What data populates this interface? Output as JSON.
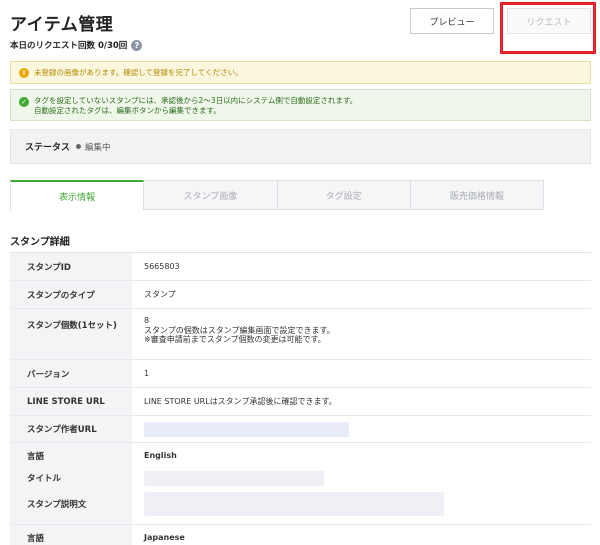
{
  "header": {
    "title": "アイテム管理",
    "request_count": "本日のリクエスト回数 0/30回",
    "help_icon": "question-circle-icon",
    "preview_label": "プレビュー",
    "request_label": "リクエスト"
  },
  "notices": {
    "warning_icon": "exclamation-circle-icon",
    "warning_text": "未登録の画像があります。確認して登録を完了してください。",
    "info_icon": "check-circle-icon",
    "info_line1": "タグを設定していないスタンプには、承認後から2〜3日以内にシステム側で自動設定されます。",
    "info_line2": "自動設定されたタグは、編集ボタンから編集できます。"
  },
  "status": {
    "label": "ステータス",
    "value": "編集中"
  },
  "tabs": [
    {
      "label": "表示情報",
      "active": true
    },
    {
      "label": "スタンプ画像",
      "active": false
    },
    {
      "label": "タグ設定",
      "active": false
    },
    {
      "label": "販売価格情報",
      "active": false
    }
  ],
  "detail": {
    "section_title": "スタンプ詳細",
    "rows": {
      "sticker_id": {
        "label": "スタンプID",
        "value": "5665803"
      },
      "sticker_type": {
        "label": "スタンプのタイプ",
        "value": "スタンプ"
      },
      "sticker_count": {
        "label": "スタンプ個数(1セット)",
        "value": "8",
        "note1": "スタンプの個数はスタンプ編集画面で設定できます。",
        "note2": "※審査申請前までスタンプ個数の変更は可能です。"
      },
      "version": {
        "label": "バージョン",
        "value": "1"
      },
      "line_store_url": {
        "label": "LINE STORE URL",
        "value": "LINE STORE URLはスタンプ承認後に確認できます。"
      },
      "creator_url": {
        "label": "スタンプ作者URL"
      },
      "english": {
        "lang_label": "言語",
        "lang_value": "English",
        "title_label": "タイトル",
        "desc_label": "スタンプ説明文"
      },
      "japanese": {
        "lang_label": "言語",
        "lang_value": "Japanese"
      }
    }
  },
  "colors": {
    "accent_green": "#3fa935",
    "highlight_red": "#e4232a",
    "warning_bg": "#fbf6de",
    "info_bg": "#eef7ea"
  }
}
